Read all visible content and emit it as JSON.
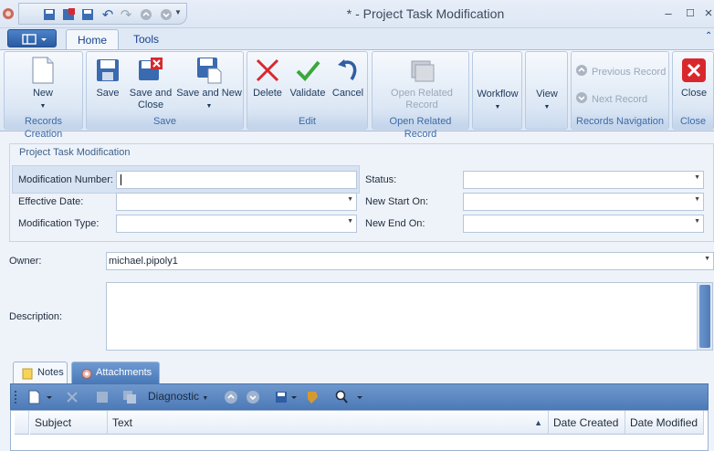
{
  "window": {
    "title": "*  - Project Task Modification"
  },
  "tabs": [
    {
      "label": "Home"
    },
    {
      "label": "Tools"
    }
  ],
  "ribbon": {
    "records_creation": {
      "label": "Records Creation",
      "new": "New"
    },
    "save": {
      "label": "Save",
      "save": "Save",
      "save_close": "Save and Close",
      "save_new": "Save and New"
    },
    "edit": {
      "label": "Edit",
      "delete": "Delete",
      "validate": "Validate",
      "cancel": "Cancel"
    },
    "open_related": {
      "label": "Open Related Record",
      "open": "Open Related Record"
    },
    "workflow": {
      "label": "Workflow"
    },
    "view": {
      "label": "View"
    },
    "nav": {
      "label": "Records Navigation",
      "prev": "Previous Record",
      "next": "Next Record"
    },
    "close": {
      "label": "Close",
      "close": "Close"
    }
  },
  "form": {
    "section_title": "Project Task Modification",
    "modification_number": {
      "label": "Modification Number:",
      "value": ""
    },
    "effective_date": {
      "label": "Effective Date:",
      "value": ""
    },
    "modification_type": {
      "label": "Modification Type:",
      "value": ""
    },
    "status": {
      "label": "Status:",
      "value": ""
    },
    "new_start_on": {
      "label": "New Start On:",
      "value": ""
    },
    "new_end_on": {
      "label": "New End On:",
      "value": ""
    },
    "owner": {
      "label": "Owner:",
      "value": "michael.pipoly1"
    },
    "description": {
      "label": "Description:",
      "value": ""
    }
  },
  "notes": {
    "tabs": [
      {
        "label": "Notes"
      },
      {
        "label": "Attachments"
      }
    ],
    "toolbar": {
      "diagnostic": "Diagnostic"
    },
    "columns": [
      "Subject",
      "Text",
      "Date Created",
      "Date Modified"
    ]
  },
  "colors": {
    "ribbon_label": "#3e6aa6",
    "accent_blue": "#4e7bb8",
    "delete_red": "#d9282d",
    "validate_green": "#3aa83a"
  }
}
